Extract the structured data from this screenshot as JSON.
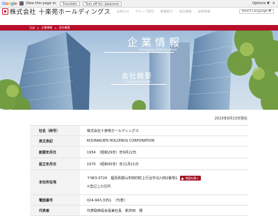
{
  "translate_bar": {
    "google": "Google",
    "prompt": "View this page in:",
    "translate_button": "Translate",
    "turn_off": "Turn off for: Japanese",
    "options": "Options ▼"
  },
  "header": {
    "company": "株式会社 十楽苑ホールディングス",
    "nav": [
      "お知らせ",
      "グループ会社",
      "事業紹介",
      "会社情報",
      "採用情報"
    ],
    "language": "Select Language ▼"
  },
  "breadcrumb": [
    "TOP",
    ">",
    "企業情報",
    ">",
    "会社概要"
  ],
  "hero": {
    "title_jp": "企業情報",
    "title_en": "Company Information",
    "subtitle_jp": "会社概要",
    "subtitle_en": "Company Profile"
  },
  "date": "2023年6月23日現在",
  "profile": [
    {
      "label": "社名（商号）",
      "value": "株式会社十楽苑ホールディングス"
    },
    {
      "label": "英文表記",
      "value": "KOURAKUEN HOLDINGS CORPORATION"
    },
    {
      "label": "創業年月日",
      "value": "1954　（昭和29年）年9月22日"
    },
    {
      "label": "設立年月日",
      "value": "1970　（昭和45年）年11月11日"
    },
    {
      "label": "本社所在地",
      "value": "〒963-0724　福島県郡山市田村町上行合字北川田2番地1",
      "button": "地図を開く",
      "note": "※登記上の住所"
    },
    {
      "label": "電話番号",
      "value": "024-943-3351　（代表）"
    },
    {
      "label": "代表者",
      "value": "代表取締役会長兼社長　新井田　傳"
    }
  ],
  "colors": {
    "brand": "#b70f2a",
    "table_label_bg": "#f3f3f3"
  }
}
